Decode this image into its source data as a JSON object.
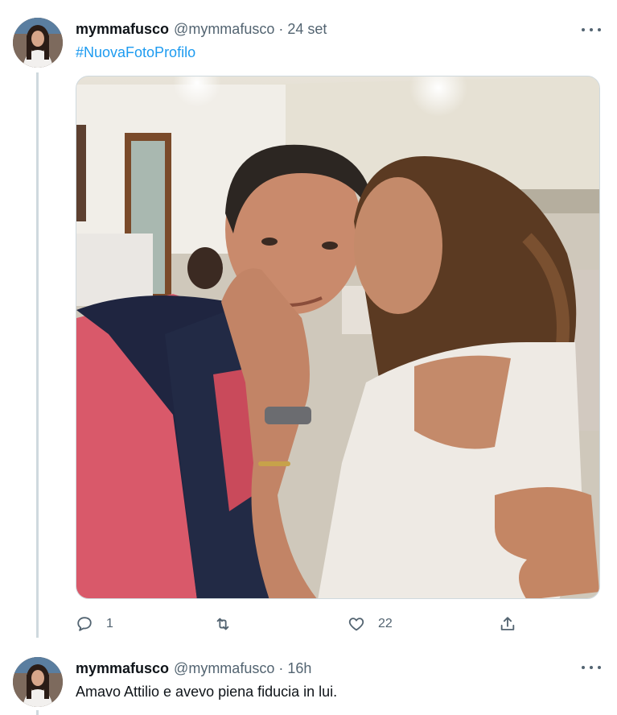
{
  "tweets": [
    {
      "display_name": "mymmafusco",
      "handle": "@mymmafusco",
      "separator": "·",
      "time": "24 set",
      "hashtag": "#NuovaFotoProfilo",
      "replies": "1",
      "retweets": "",
      "likes": "22"
    },
    {
      "display_name": "mymmafusco",
      "handle": "@mymmafusco",
      "separator": "·",
      "time": "16h",
      "text": "Amavo Attilio e avevo piena fiducia in lui."
    }
  ],
  "icons": {
    "reply": "reply-icon",
    "retweet": "retweet-icon",
    "like": "heart-icon",
    "share": "share-icon",
    "more": "more-dots-icon"
  },
  "colors": {
    "accent": "#1d9bf0",
    "secondary_text": "#536471",
    "thread_line": "#cfd9de"
  }
}
